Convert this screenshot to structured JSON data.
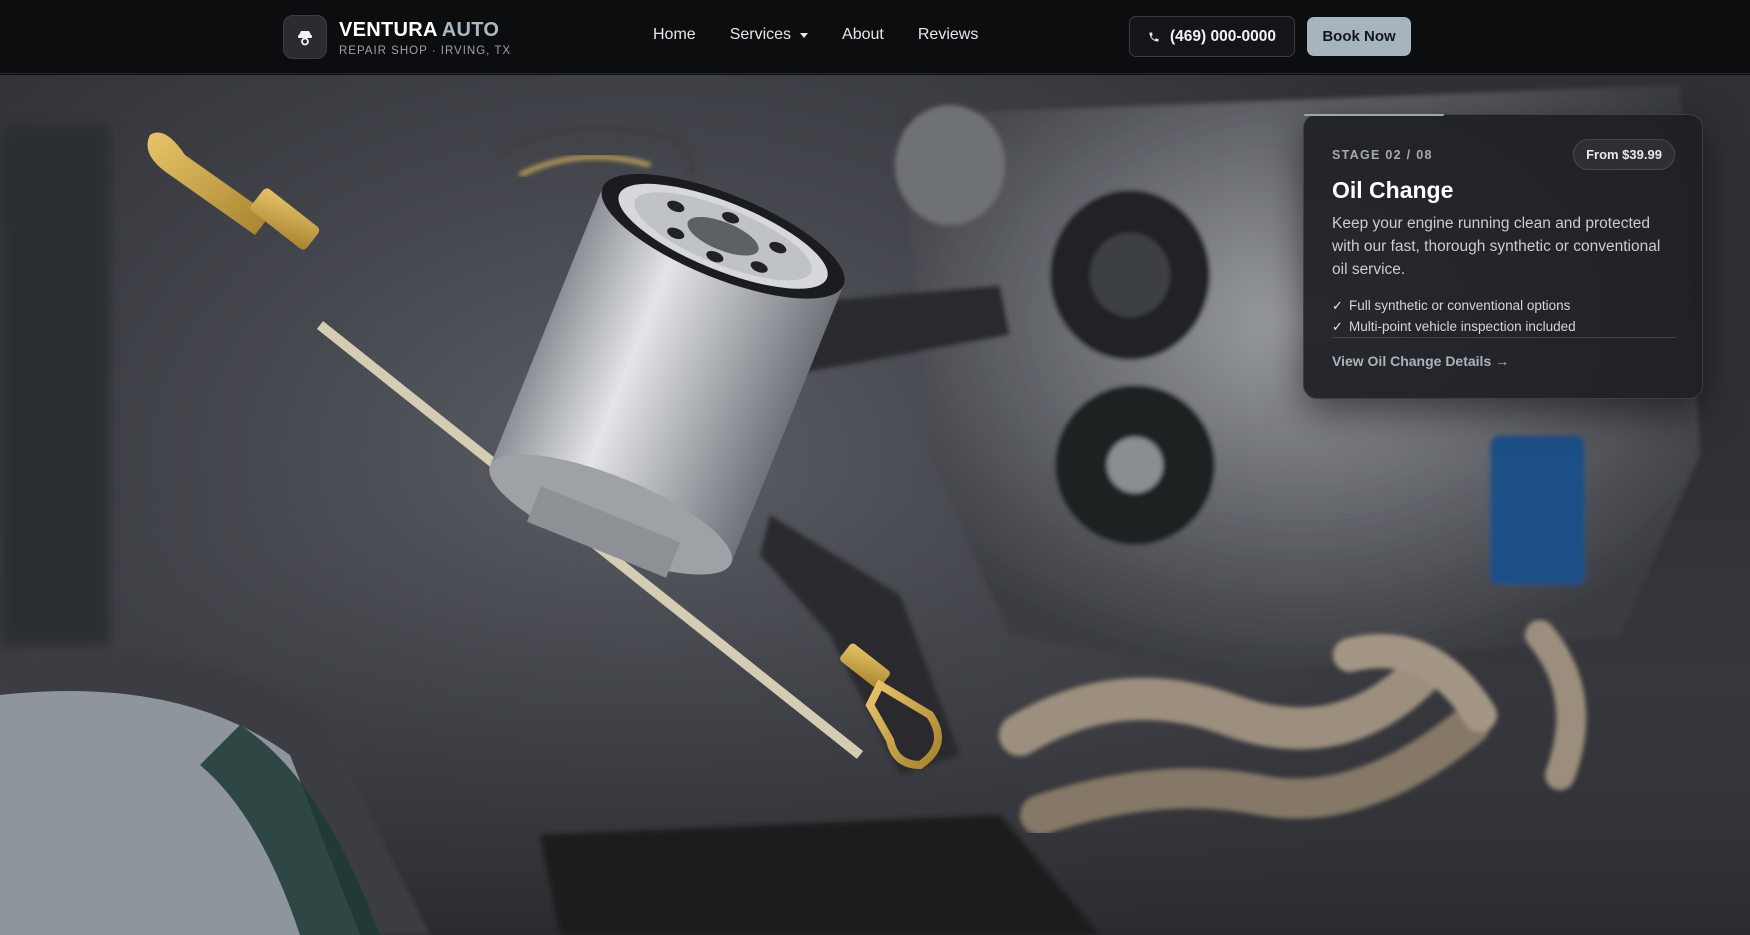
{
  "brand": {
    "name_primary": "VENTURA",
    "name_accent": "AUTO",
    "subtitle": "REPAIR SHOP · IRVING, TX",
    "badge_icon": "car-icon"
  },
  "nav": {
    "items": [
      {
        "label": "Home"
      },
      {
        "label": "Services",
        "has_dropdown": true
      },
      {
        "label": "About"
      },
      {
        "label": "Reviews"
      }
    ]
  },
  "header_actions": {
    "phone_label": "(469) 000-0000",
    "phone_icon": "phone-icon",
    "book_label": "Book Now"
  },
  "service_card": {
    "stage": "STAGE 02 / 08",
    "price": "From $39.99",
    "title": "Oil Change",
    "description": "Keep your engine running clean and protected with our fast, thorough synthetic or conventional oil service.",
    "features": [
      "Full synthetic or conventional options",
      "Multi-point vehicle inspection included"
    ],
    "link_label": "View Oil Change Details →"
  },
  "colors": {
    "header_bg": "#0c0d0f",
    "accent": "#a6b4c0",
    "card_bg": "#1e1f23"
  }
}
